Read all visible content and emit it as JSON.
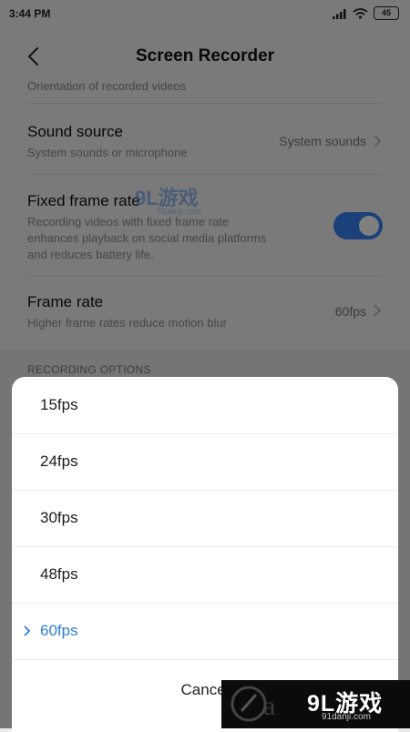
{
  "status_bar": {
    "time": "3:44 PM",
    "battery": "45"
  },
  "header": {
    "title": "Screen Recorder"
  },
  "settings": {
    "clipped_subtitle": "Orientation of recorded videos",
    "sound_source": {
      "title": "Sound source",
      "subtitle": "System sounds or microphone",
      "value": "System sounds"
    },
    "fixed_frame_rate": {
      "title": "Fixed frame rate",
      "subtitle_lines": [
        "Recording videos with fixed frame rate",
        "enhances playback on social media platforms",
        "and reduces battery life."
      ],
      "enabled": true
    },
    "frame_rate": {
      "title": "Frame rate",
      "subtitle": "Higher frame rates reduce motion blur",
      "value": "60fps"
    }
  },
  "section": {
    "label": "RECORDING OPTIONS"
  },
  "sheet": {
    "options": [
      {
        "label": "15fps",
        "selected": false
      },
      {
        "label": "24fps",
        "selected": false
      },
      {
        "label": "30fps",
        "selected": false
      },
      {
        "label": "48fps",
        "selected": false
      },
      {
        "label": "60fps",
        "selected": true
      }
    ],
    "cancel_label": "Cancel"
  },
  "watermark": {
    "text": "9L游戏",
    "sub": "91danji.com"
  },
  "logo": {
    "text": "9L游戏",
    "sub": "91danji.com"
  },
  "colors": {
    "accent": "#2a7fd8",
    "toggle_on": "#3482f3"
  }
}
